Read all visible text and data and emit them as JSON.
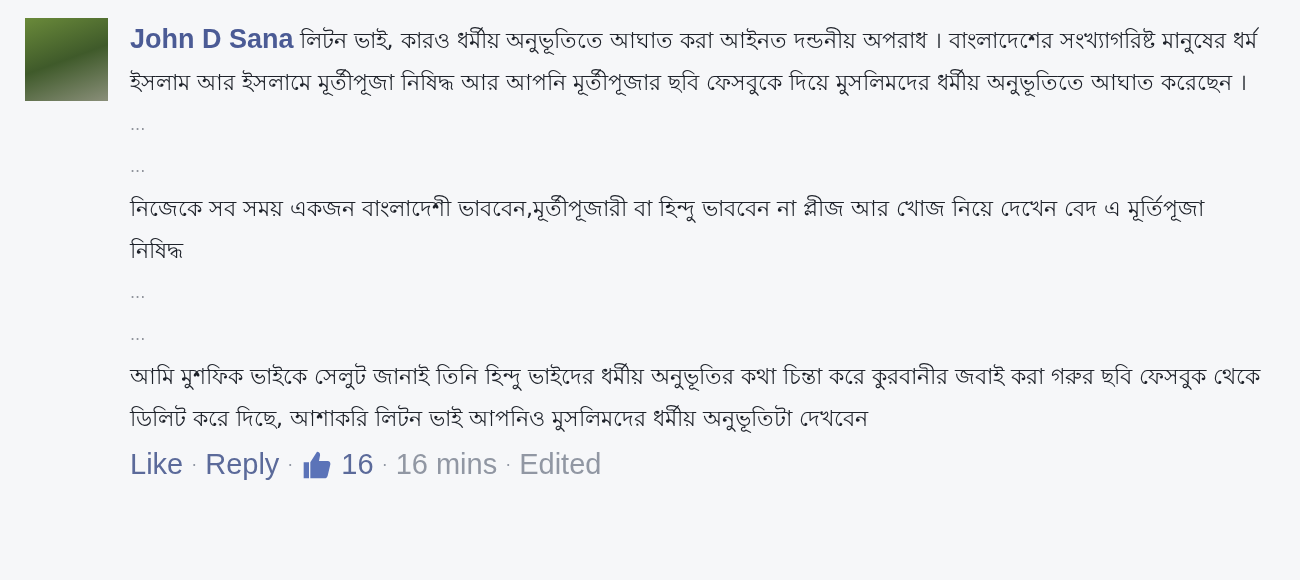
{
  "comment": {
    "author": "John D Sana",
    "blocks": [
      {
        "kind": "text",
        "text": "লিটন ভাই, কারও ধর্মীয় অনুভূতিতে আঘাত করা আইনত দন্ডনীয় অপরাধ । বাংলাদেশের সংখ্যাগরিষ্ট মানুষের ধর্ম ইসলাম আর ইসলামে মূর্তীপূজা নিষিদ্ধ আর আপনি মূর্তীপূজার ছবি ফেসবুকে দিয়ে মুসলিমদের ধর্মীয় অনুভূতিতে আঘাত করেছেন ।"
      },
      {
        "kind": "ellipsis",
        "text": "..."
      },
      {
        "kind": "ellipsis",
        "text": "..."
      },
      {
        "kind": "text",
        "text": "নিজেকে সব সময় একজন বাংলাদেশী ভাববেন,মূর্তীপূজারী বা হিন্দু ভাববেন না প্লীজ আর খোজ নিয়ে দেখেন বেদ এ মূর্তিপূজা নিষিদ্ধ"
      },
      {
        "kind": "ellipsis",
        "text": "..."
      },
      {
        "kind": "ellipsis",
        "text": "..."
      },
      {
        "kind": "text",
        "text": "আমি মুশফিক ভাইকে সেলুট জানাই তিনি হিন্দু ভাইদের ধর্মীয় অনুভূতির কথা চিন্তা করে কুরবানীর জবাই করা গরুর ছবি ফেসবুক থেকে ডিলিট করে দিছে, আশাকরি লিটন ভাই আপনিও মুসলিমদের ধর্মীয় অনুভূতিটা দেখবেন"
      }
    ],
    "actions": [
      {
        "kind": "link",
        "text": "Like"
      },
      {
        "kind": "link",
        "text": "Reply"
      },
      {
        "kind": "likes",
        "text": "16"
      },
      {
        "kind": "meta",
        "text": "16 mins"
      },
      {
        "kind": "meta",
        "text": "Edited"
      }
    ],
    "separator": "·"
  }
}
